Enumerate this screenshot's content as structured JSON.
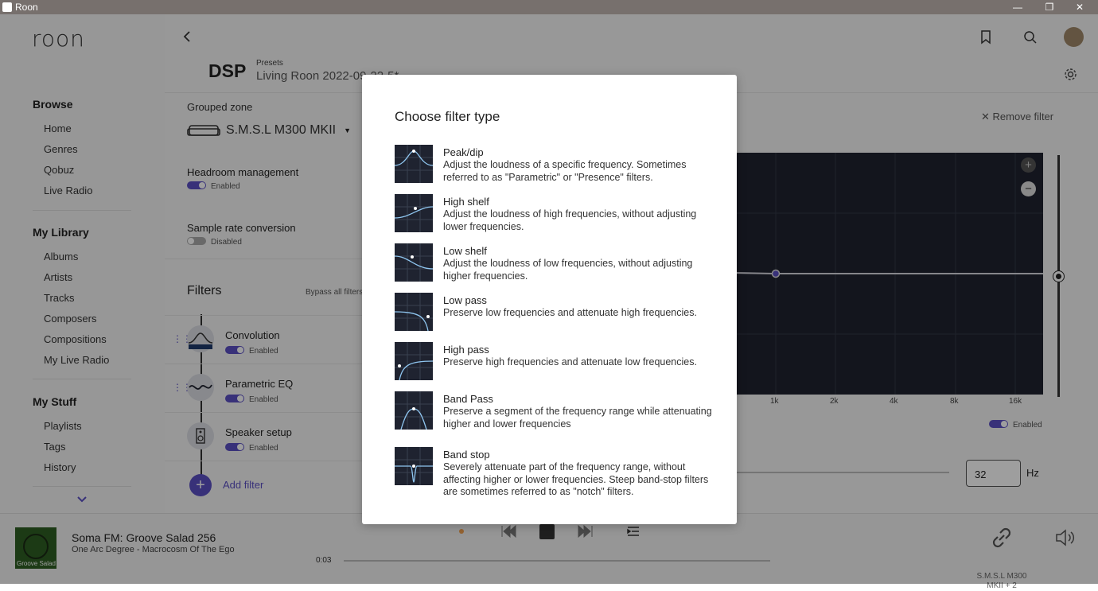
{
  "titlebar": {
    "app_name": "Roon",
    "minimize": "—",
    "maximize": "❐",
    "close": "✕"
  },
  "sidebar": {
    "logo": "roon",
    "browse": {
      "title": "Browse",
      "items": [
        "Home",
        "Genres",
        "Qobuz",
        "Live Radio"
      ]
    },
    "library": {
      "title": "My Library",
      "items": [
        "Albums",
        "Artists",
        "Tracks",
        "Composers",
        "Compositions",
        "My Live Radio"
      ]
    },
    "stuff": {
      "title": "My Stuff",
      "items": [
        "Playlists",
        "Tags",
        "History"
      ]
    }
  },
  "header": {
    "title": "DSP",
    "presets_label": "Presets",
    "preset_name": "Living Roon 2022-09-22-5*"
  },
  "left_panel": {
    "grouped_zone_label": "Grouped zone",
    "zone_name": "S.M.S.L M300 MKII",
    "headroom": {
      "label": "Headroom management",
      "status": "Enabled"
    },
    "sample_rate": {
      "label": "Sample rate conversion",
      "status": "Disabled"
    },
    "filters_title": "Filters",
    "bypass_label": "Bypass all filters",
    "filters": [
      {
        "name": "Convolution",
        "status": "Enabled"
      },
      {
        "name": "Parametric EQ",
        "status": "Enabled"
      },
      {
        "name": "Speaker setup",
        "status": "Enabled"
      }
    ],
    "add_filter": "Add filter"
  },
  "right_panel": {
    "remove_filter": "Remove filter",
    "x_ticks": [
      "1k",
      "2k",
      "4k",
      "8k",
      "16k"
    ],
    "enabled_label": "Enabled",
    "freq_value": "32",
    "freq_unit": "Hz"
  },
  "player": {
    "album_label": "Groove Salad",
    "track_title": "Soma FM: Groove Salad 256",
    "track_subtitle": "One Arc Degree - Macrocosm Of The Ego",
    "elapsed": "0:03",
    "progress": 0.0,
    "zone_line1": "S.M.S.L M300",
    "zone_line2": "MKII + 2"
  },
  "modal": {
    "title": "Choose filter type",
    "options": [
      {
        "name": "Peak/dip",
        "desc": "Adjust the loudness of a specific frequency. Sometimes referred to as \"Parametric\" or \"Presence\" filters.",
        "icon": "peak-dip-icon"
      },
      {
        "name": "High shelf",
        "desc": "Adjust the loudness of high frequencies, without adjusting lower frequencies.",
        "icon": "high-shelf-icon"
      },
      {
        "name": "Low shelf",
        "desc": "Adjust the loudness of low frequencies, without adjusting higher frequencies.",
        "icon": "low-shelf-icon"
      },
      {
        "name": "Low pass",
        "desc": "Preserve low frequencies and attenuate high frequencies.",
        "icon": "low-pass-icon"
      },
      {
        "name": "High pass",
        "desc": "Preserve high frequencies and attenuate low frequencies.",
        "icon": "high-pass-icon"
      },
      {
        "name": "Band Pass",
        "desc": "Preserve a segment of the frequency range while attenuating higher and lower frequencies",
        "icon": "band-pass-icon"
      },
      {
        "name": "Band stop",
        "desc": "Severely attenuate part of the frequency range, without affecting higher or lower frequencies. Steep band-stop filters are sometimes referred to as \"notch\" filters.",
        "icon": "band-stop-icon"
      }
    ]
  },
  "colors": {
    "accent": "#5b4fc4",
    "graph_bg": "#1f2330",
    "curve": "#8fc6f0"
  }
}
